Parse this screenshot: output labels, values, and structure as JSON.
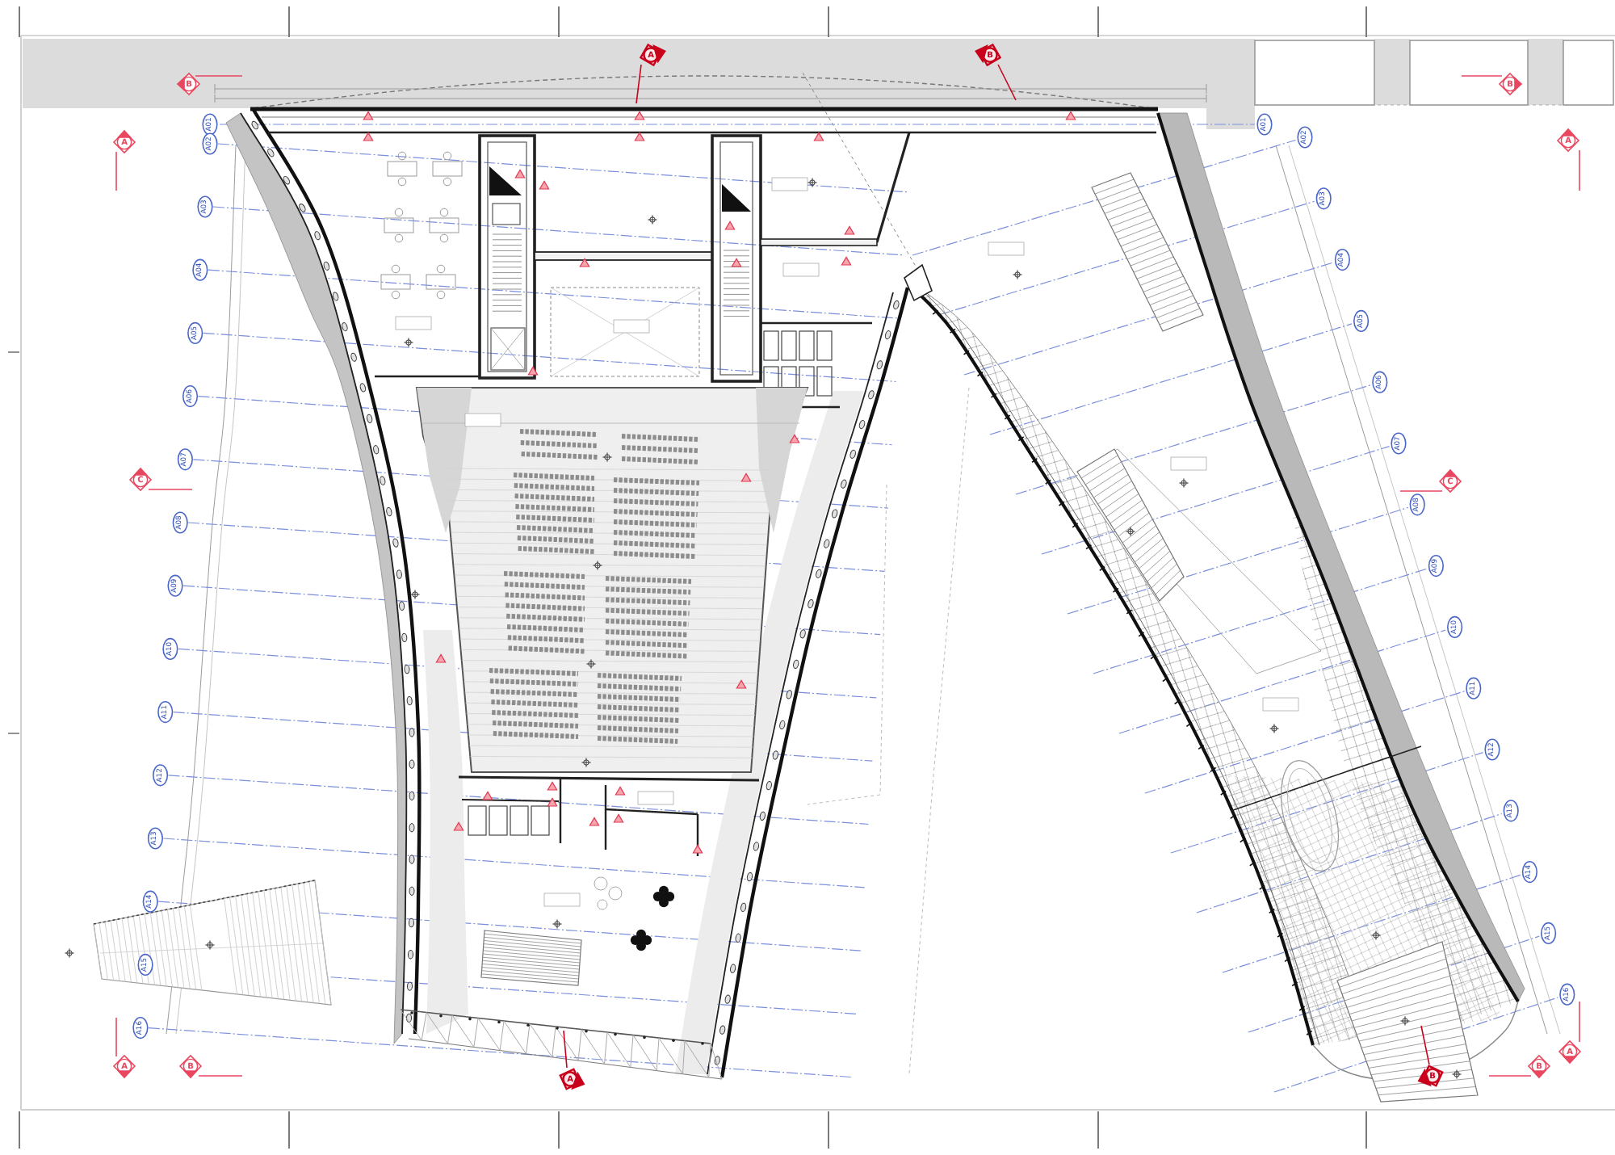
{
  "grid_axes": {
    "left": [
      {
        "label": "A01"
      },
      {
        "label": "A02"
      },
      {
        "label": "A03"
      },
      {
        "label": "A04"
      },
      {
        "label": "A05"
      },
      {
        "label": "A06"
      },
      {
        "label": "A07"
      },
      {
        "label": "A08"
      },
      {
        "label": "A09"
      },
      {
        "label": "A10"
      },
      {
        "label": "A11"
      },
      {
        "label": "A12"
      },
      {
        "label": "A13"
      },
      {
        "label": "A14"
      },
      {
        "label": "A15"
      },
      {
        "label": "A16"
      }
    ],
    "right": [
      {
        "label": "A01"
      },
      {
        "label": "A02"
      },
      {
        "label": "A03"
      },
      {
        "label": "A04"
      },
      {
        "label": "A05"
      },
      {
        "label": "A06"
      },
      {
        "label": "A07"
      },
      {
        "label": "A08"
      },
      {
        "label": "A09"
      },
      {
        "label": "A10"
      },
      {
        "label": "A11"
      },
      {
        "label": "A12"
      },
      {
        "label": "A13"
      },
      {
        "label": "A14"
      },
      {
        "label": "A15"
      },
      {
        "label": "A16"
      }
    ]
  },
  "section_markers": [
    {
      "kind": "section",
      "letter": "B"
    },
    {
      "kind": "section",
      "letter": "A"
    },
    {
      "kind": "elevation",
      "letter": "A"
    },
    {
      "kind": "elevation",
      "letter": "B"
    },
    {
      "kind": "section",
      "letter": "B"
    },
    {
      "kind": "section",
      "letter": "A"
    },
    {
      "kind": "section",
      "letter": "C"
    },
    {
      "kind": "section",
      "letter": "C"
    },
    {
      "kind": "section",
      "letter": "A"
    },
    {
      "kind": "section",
      "letter": "B"
    },
    {
      "kind": "elevation",
      "letter": "A"
    },
    {
      "kind": "elevation",
      "letter": "B"
    },
    {
      "kind": "section",
      "letter": "B"
    },
    {
      "kind": "section",
      "letter": "A"
    }
  ]
}
